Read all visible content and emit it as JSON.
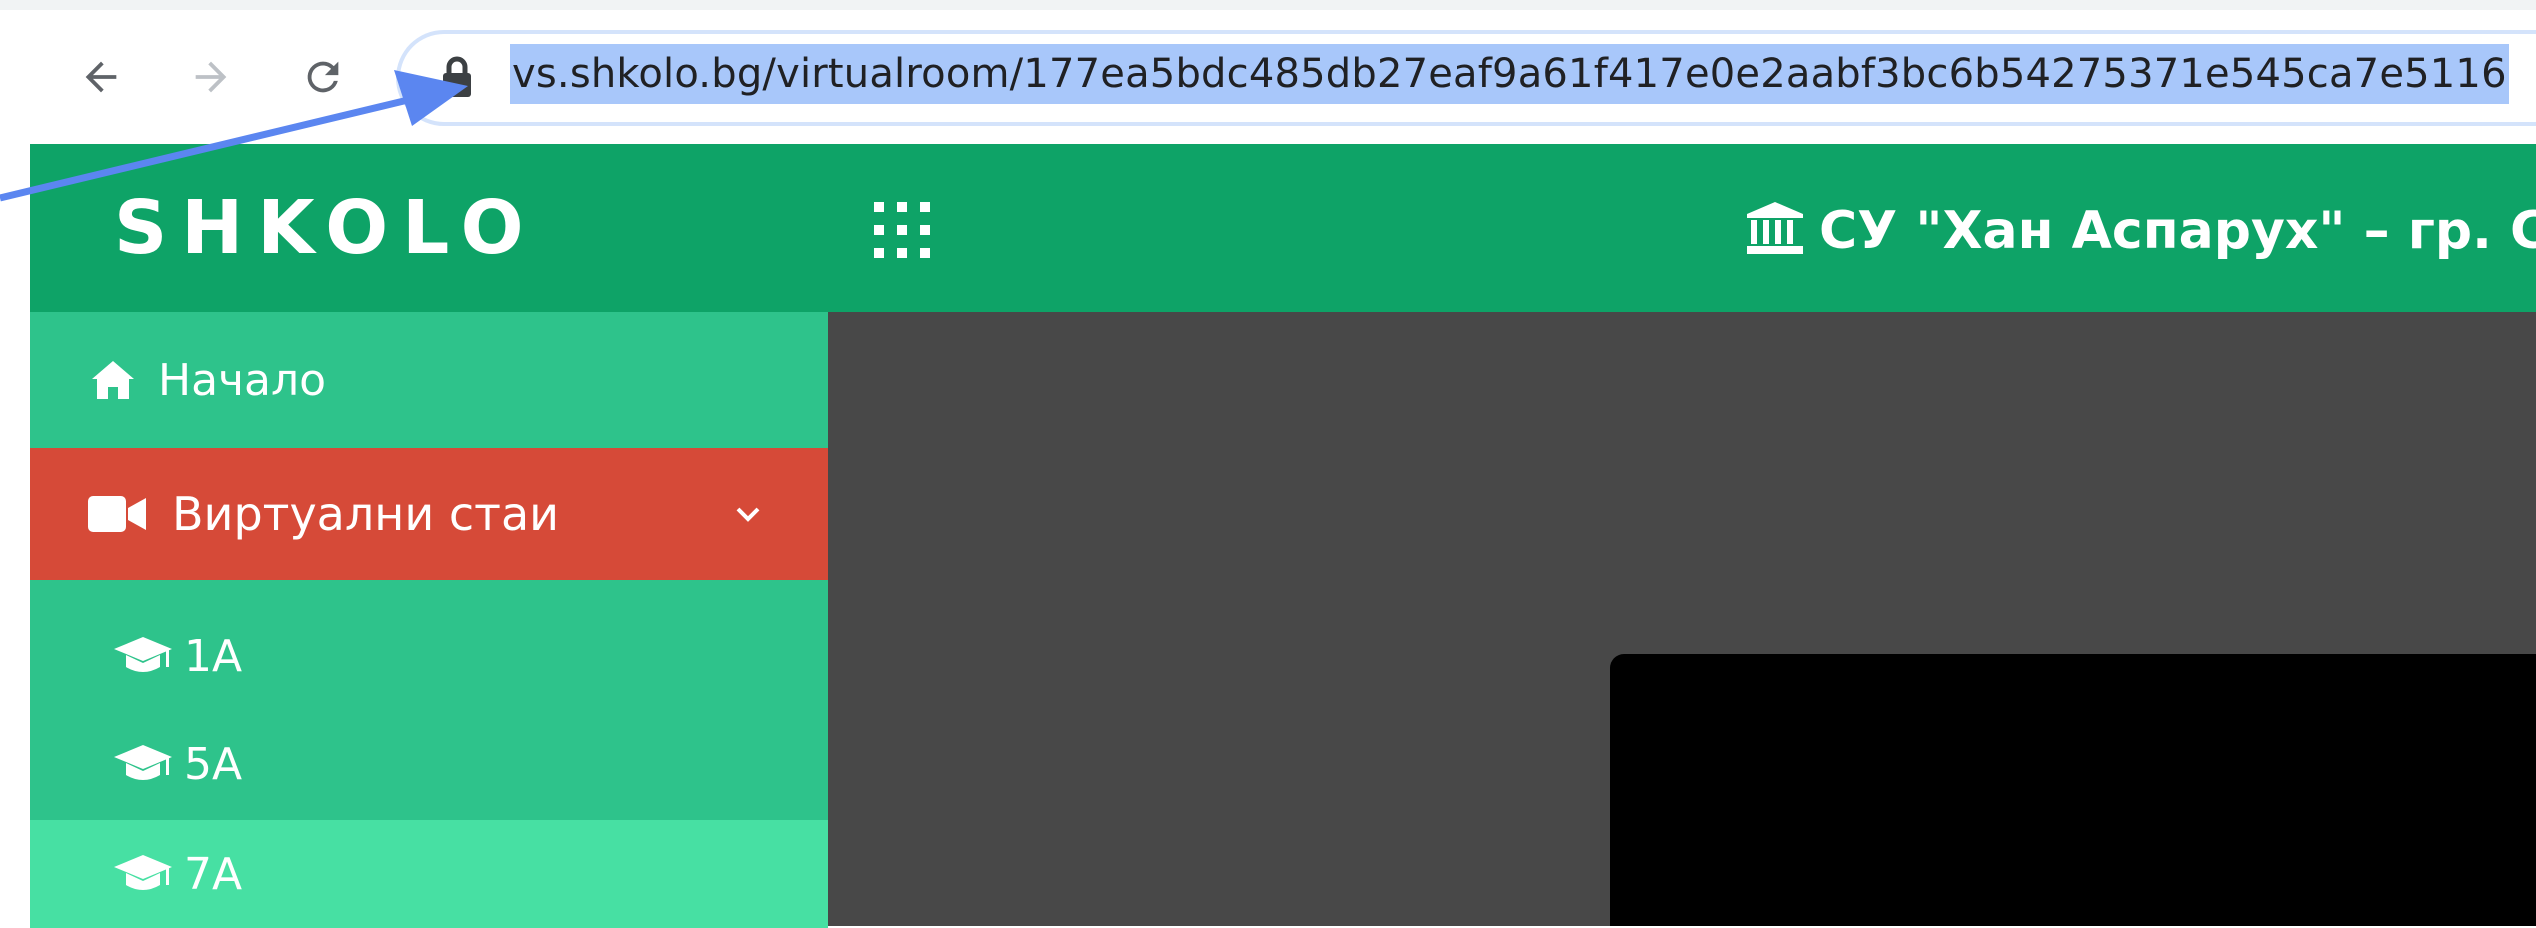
{
  "browser": {
    "url": "vs.shkolo.bg/virtualroom/177ea5bdc485db27eaf9a61f417e0e2aabf3bc6b54275371e545ca7e5116",
    "icons": [
      "back-arrow-icon",
      "forward-arrow-icon",
      "reload-icon",
      "lock-icon"
    ]
  },
  "header": {
    "logo": "SHKOLO",
    "school_name": "СУ \"Хан Аспарух\" – гр. Со",
    "icons": [
      "apps-grid-icon",
      "bank-building-icon"
    ],
    "bg_color": "#0ea367"
  },
  "sidebar": {
    "home_label": "Начало",
    "virtual_rooms_label": "Виртуални стаи",
    "rooms": [
      {
        "label": "1А",
        "active": false
      },
      {
        "label": "5А",
        "active": false
      },
      {
        "label": "7А",
        "active": true
      }
    ],
    "colors": {
      "base": "#2ec38b",
      "active_section": "#d64a38",
      "active_item": "#47e0a3"
    }
  },
  "main": {
    "bg_color": "#484848",
    "video_bg": "#000000"
  },
  "annotation": {
    "color": "#5b86f0"
  }
}
